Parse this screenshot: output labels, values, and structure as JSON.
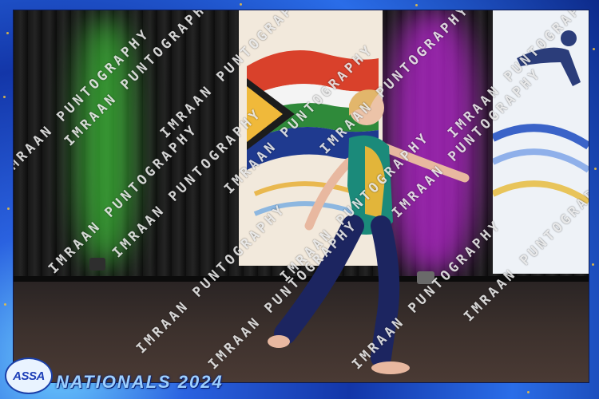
{
  "watermark": {
    "text": "IMRAAN PUNTOGRAPHY"
  },
  "logo": {
    "text": "ASSA"
  },
  "event": {
    "title": "NATIONALS 2024"
  },
  "colors": {
    "frame": "#1b3fb0",
    "accent": "#f3c33b",
    "stage_light_left": "#3fbf3a",
    "stage_light_right": "#b227c9"
  }
}
